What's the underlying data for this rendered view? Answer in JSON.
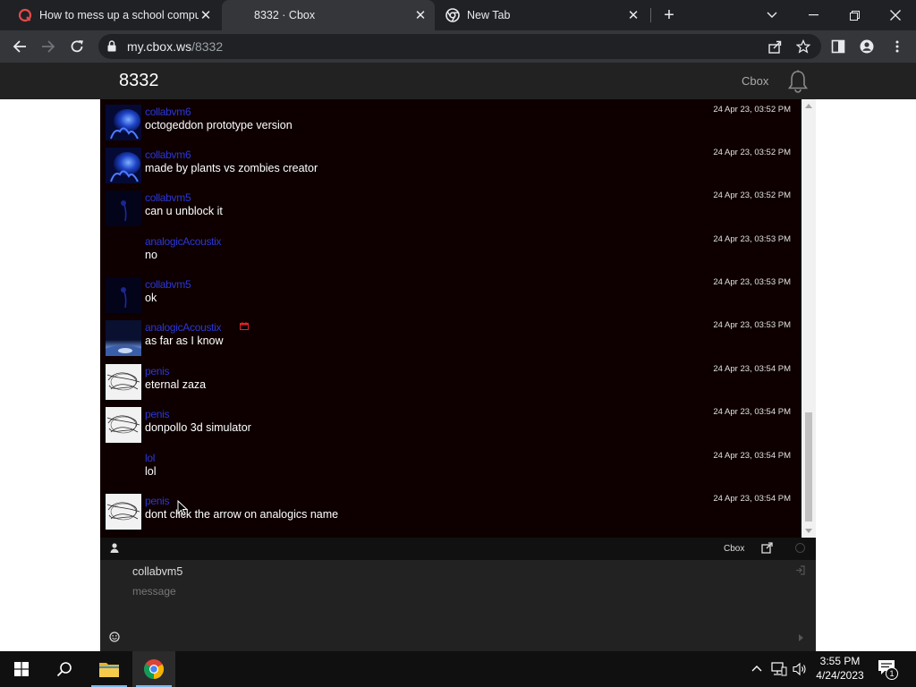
{
  "browser": {
    "tabs": [
      {
        "title": "How to mess up a school computer",
        "icon": "quora-icon",
        "active": false
      },
      {
        "title": "8332 · Cbox",
        "icon": "",
        "active": true
      },
      {
        "title": "New Tab",
        "icon": "chrome-icon",
        "active": false
      }
    ],
    "new_tab": "+",
    "url_host": "my.cbox.ws",
    "url_path": "/8332"
  },
  "page": {
    "title": "8332",
    "cbox_link": "Cbox"
  },
  "messages": [
    {
      "name": "collabvm6",
      "text": "octogeddon prototype version",
      "time": "24 Apr 23, 03:52 PM",
      "avatar": "blue-jellyfish"
    },
    {
      "name": "collabvm6",
      "text": "made by plants vs zombies creator",
      "time": "24 Apr 23, 03:52 PM",
      "avatar": "blue-jellyfish"
    },
    {
      "name": "collabvm5",
      "text": "can u unblock it",
      "time": "24 Apr 23, 03:52 PM",
      "avatar": "dark"
    },
    {
      "name": "analogicAcoustix",
      "text": "no",
      "time": "24 Apr 23, 03:53 PM",
      "avatar": "none"
    },
    {
      "name": "collabvm5",
      "text": "ok",
      "time": "24 Apr 23, 03:53 PM",
      "avatar": "dark"
    },
    {
      "name": "analogicAcoustix",
      "text": "as far as I know",
      "time": "24 Apr 23, 03:53 PM",
      "avatar": "planet"
    },
    {
      "name": "penis",
      "text": "eternal zaza",
      "time": "24 Apr 23, 03:54 PM",
      "avatar": "sketch"
    },
    {
      "name": "penis",
      "text": "donpollo 3d simulator",
      "time": "24 Apr 23, 03:54 PM",
      "avatar": "sketch"
    },
    {
      "name": "lol",
      "text": "lol",
      "time": "24 Apr 23, 03:54 PM",
      "avatar": "none"
    },
    {
      "name": "penis",
      "text": "dont click the arrow on analogics name",
      "time": "24 Apr 23, 03:54 PM",
      "avatar": "sketch"
    }
  ],
  "chat_bar": {
    "cbox_label": "Cbox"
  },
  "compose": {
    "user_name": "collabvm5",
    "placeholder": "message"
  },
  "taskbar": {
    "time": "3:55 PM",
    "date": "4/24/2023",
    "notification_count": "1"
  },
  "colors": {
    "username": "#2a37d6",
    "chat_background": "#0e0000",
    "header": "#222222"
  }
}
